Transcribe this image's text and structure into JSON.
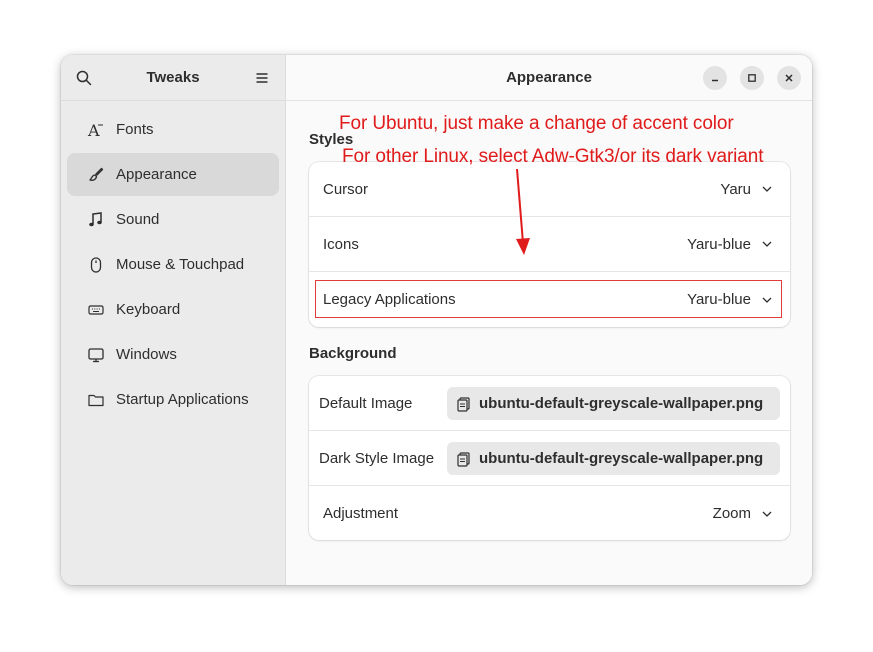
{
  "sidebar": {
    "title": "Tweaks",
    "items": [
      {
        "label": "Fonts",
        "icon": "font-icon"
      },
      {
        "label": "Appearance",
        "icon": "brush-icon",
        "selected": true
      },
      {
        "label": "Sound",
        "icon": "music-note-icon"
      },
      {
        "label": "Mouse & Touchpad",
        "icon": "mouse-icon"
      },
      {
        "label": "Keyboard",
        "icon": "keyboard-icon"
      },
      {
        "label": "Windows",
        "icon": "monitor-icon"
      },
      {
        "label": "Startup Applications",
        "icon": "folder-icon"
      }
    ]
  },
  "main": {
    "title": "Appearance",
    "styles": {
      "title": "Styles",
      "rows": [
        {
          "label": "Cursor",
          "value": "Yaru"
        },
        {
          "label": "Icons",
          "value": "Yaru-blue"
        },
        {
          "label": "Legacy Applications",
          "value": "Yaru-blue"
        }
      ]
    },
    "background": {
      "title": "Background",
      "default_image_label": "Default Image",
      "default_image_value": "ubuntu-default-greyscale-wallpaper.png",
      "dark_image_label": "Dark Style Image",
      "dark_image_value": "ubuntu-default-greyscale-wallpaper.png",
      "adjustment_label": "Adjustment",
      "adjustment_value": "Zoom"
    }
  },
  "annotation": {
    "line1": "For Ubuntu, just make a change of accent color",
    "line2": "For other Linux, select Adw-Gtk3/or  its dark variant",
    "color": "#e01b1b"
  }
}
